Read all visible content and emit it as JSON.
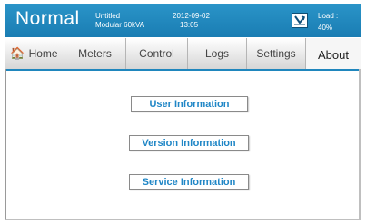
{
  "header": {
    "status": "Normal",
    "model_line1": "Untitled",
    "model_line2": "Modular 60kVA",
    "date": "2012-09-02",
    "time": "13:05",
    "load_label": "Load :",
    "load_value": "40%",
    "ups_icon": "ups-status-icon"
  },
  "tabs": [
    {
      "label": "Home",
      "icon": "home-icon"
    },
    {
      "label": "Meters"
    },
    {
      "label": "Control"
    },
    {
      "label": "Logs"
    },
    {
      "label": "Settings"
    },
    {
      "label": "About"
    }
  ],
  "active_tab": "About",
  "about": {
    "user_info": "User Information",
    "version_info": "Version Information",
    "service_info": "Service Information"
  },
  "colors": {
    "header_bg": "#1a86bf",
    "button_text": "#1f86c6"
  }
}
